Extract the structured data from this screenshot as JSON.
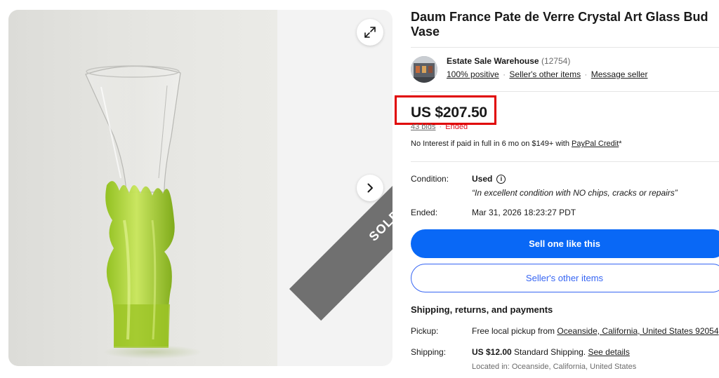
{
  "listing": {
    "title": "Daum France Pate de Verre Crystal Art Glass Bud Vase",
    "sold_label": "SOLD"
  },
  "seller": {
    "name": "Estate Sale Warehouse",
    "feedback_count": "(12754)",
    "positive": "100% positive",
    "other_items_link": "Seller's other items",
    "message_link": "Message seller",
    "separator": "·"
  },
  "price": {
    "amount": "US $207.50",
    "bids": "43 bids",
    "status": "Ended",
    "financing_text": "No Interest if paid in full in 6 mo on $149+ with ",
    "financing_link": "PayPal Credit",
    "financing_suffix": "*"
  },
  "details": {
    "condition_label": "Condition:",
    "condition_value": "Used",
    "condition_note": "“In excellent condition with NO chips, cracks or repairs”",
    "ended_label": "Ended:",
    "ended_value": "Mar 31, 2026 18:23:27 PDT"
  },
  "actions": {
    "sell_one": "Sell one like this",
    "other_items": "Seller's other items"
  },
  "shipping": {
    "heading": "Shipping, returns, and payments",
    "pickup_label": "Pickup:",
    "pickup_prefix": "Free local pickup from ",
    "pickup_location": "Oceanside, California, United States 92054",
    "shipping_label": "Shipping:",
    "shipping_price": "US $12.00",
    "shipping_method": " Standard Shipping. ",
    "see_details": "See details",
    "located": "Located in: Oceanside, California, United States"
  },
  "icons": {
    "expand": "expand-icon",
    "next": "chevron-right-icon",
    "info": "info-icon"
  },
  "colors": {
    "primary_button": "#0968f6",
    "secondary_border": "#3665f3",
    "ended_red": "#e0101d",
    "highlight_box": "#e00000",
    "sold_ribbon": "#707070",
    "vase_green": "#a8cc2a"
  }
}
